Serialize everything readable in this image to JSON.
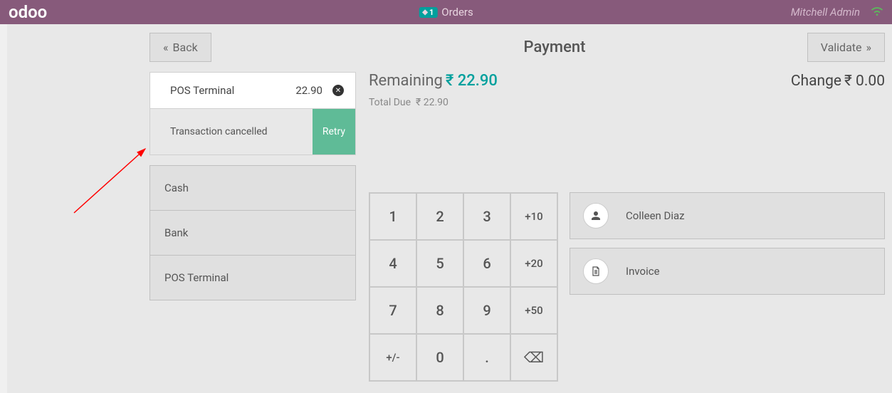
{
  "topbar": {
    "logo": "odoo",
    "orders_count": "1",
    "orders_label": "Orders",
    "user": "Mitchell Admin"
  },
  "header": {
    "back_label": "Back",
    "title": "Payment",
    "validate_label": "Validate"
  },
  "payment_line": {
    "method": "POS Terminal",
    "amount": "22.90"
  },
  "transaction": {
    "message": "Transaction cancelled",
    "retry_label": "Retry"
  },
  "payment_methods": [
    "Cash",
    "Bank",
    "POS Terminal"
  ],
  "summary": {
    "remaining_label": "Remaining",
    "remaining_amount": "₹ 22.90",
    "change_label": "Change",
    "change_amount": "₹ 0.00",
    "total_due_label": "Total Due",
    "total_due_amount": "₹ 22.90"
  },
  "numpad": {
    "k1": "1",
    "k2": "2",
    "k3": "3",
    "kp10": "+10",
    "k4": "4",
    "k5": "5",
    "k6": "6",
    "kp20": "+20",
    "k7": "7",
    "k8": "8",
    "k9": "9",
    "kp50": "+50",
    "ksign": "+/-",
    "k0": "0",
    "kdot": ".",
    "kdel": "⌫"
  },
  "actions": {
    "customer_label": "Colleen Diaz",
    "invoice_label": "Invoice"
  }
}
